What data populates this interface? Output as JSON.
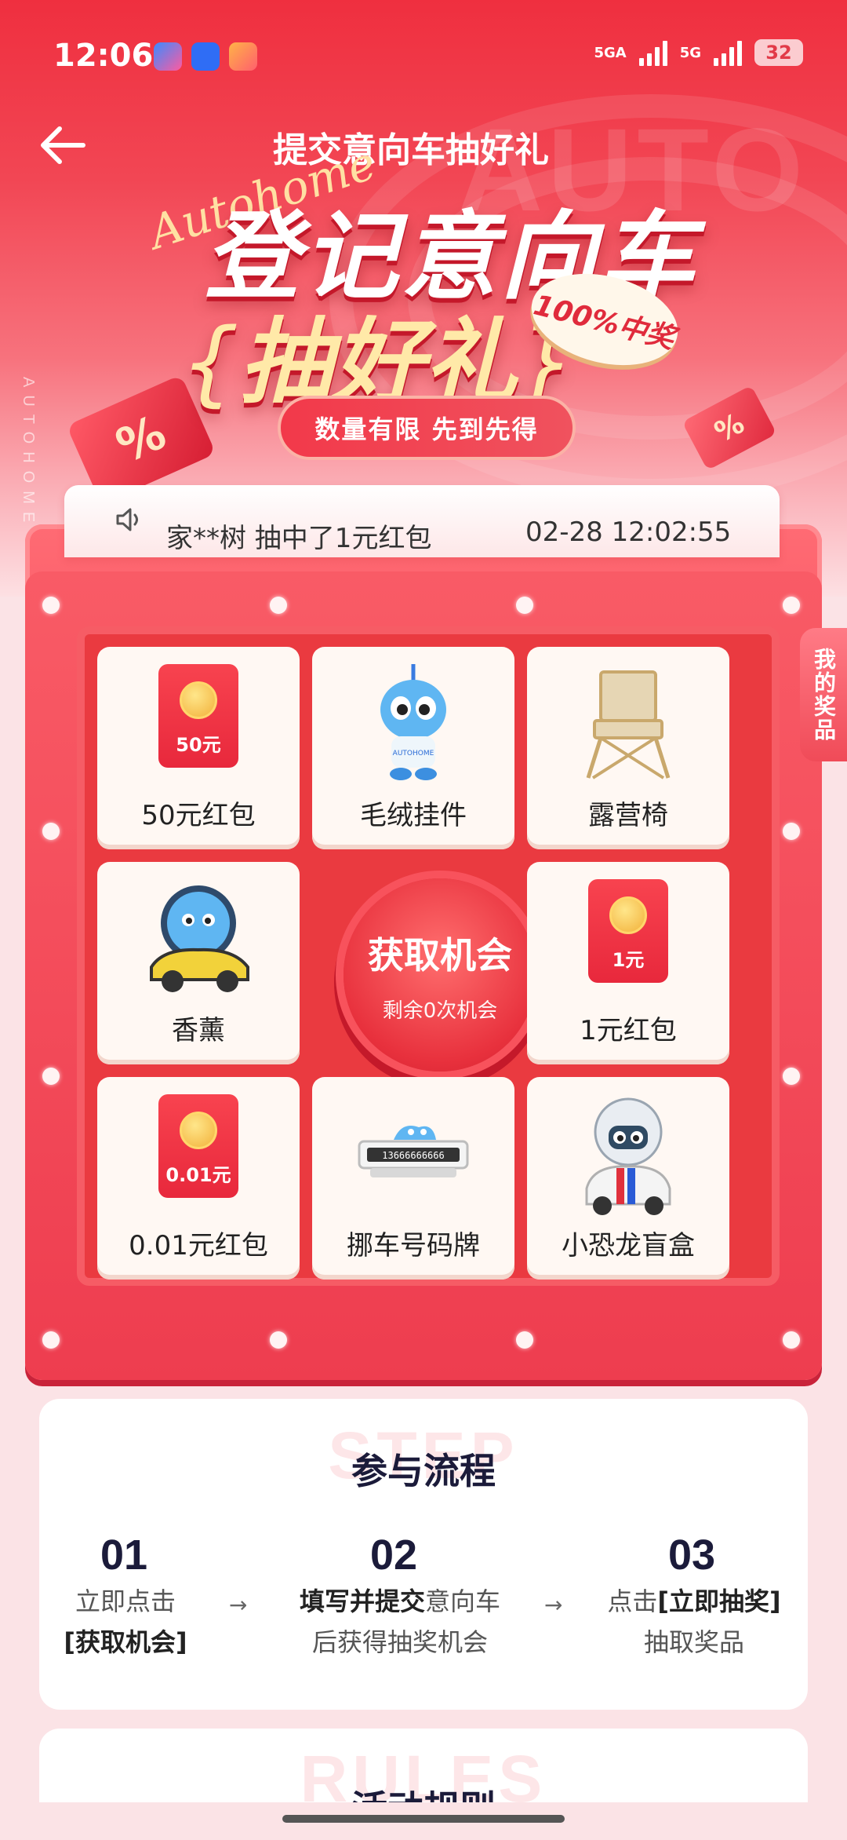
{
  "status_bar": {
    "time": "12:06",
    "network_1": "5GA",
    "network_2": "5G",
    "battery": "32"
  },
  "header": {
    "title": "提交意向车抽好礼",
    "brand_script": "Autohome",
    "watermark": "AUTO",
    "headline_line1": "登记意向车",
    "headline_line2": "抽好礼",
    "guarantee": "100%中奖",
    "limited_badge": "数量有限  先到先得",
    "vertical_brand": "AUTOHOME"
  },
  "ticker": {
    "message": "家**树 抽中了1元红包",
    "timestamp": "02-28 12:02:55"
  },
  "my_prizes_tab": "我的奖品",
  "prize_grid": {
    "center_button": {
      "label": "获取机会",
      "remaining": "剩余0次机会"
    },
    "prizes": [
      {
        "name": "50元红包",
        "amount": "50元",
        "type": "envelope"
      },
      {
        "name": "毛绒挂件",
        "type": "plush"
      },
      {
        "name": "露营椅",
        "type": "chair"
      },
      {
        "name": "香薰",
        "type": "aroma"
      },
      {
        "name": "1元红包",
        "amount": "1元",
        "type": "envelope"
      },
      {
        "name": "0.01元红包",
        "amount": "0.01元",
        "type": "envelope"
      },
      {
        "name": "挪车号码牌",
        "type": "plate"
      },
      {
        "name": "小恐龙盲盒",
        "type": "blindbox"
      }
    ]
  },
  "steps": {
    "watermark": "STEP",
    "title": "参与流程",
    "items": [
      {
        "num": "01",
        "line1": "立即点击",
        "line2": "[获取机会]"
      },
      {
        "num": "02",
        "line1_bold": "填写并提交",
        "line1_rest": "意向车",
        "line2": "后获得抽奖机会"
      },
      {
        "num": "03",
        "line1_rest": "点击",
        "line1_bold": "[立即抽奖]",
        "line2": "抽取奖品"
      }
    ]
  },
  "rules": {
    "watermark": "RULES",
    "title": "活动规则"
  },
  "colors": {
    "primary_red": "#ef2f3f",
    "gold": "#ffe9a8",
    "dark_text": "#1b1b3a"
  }
}
